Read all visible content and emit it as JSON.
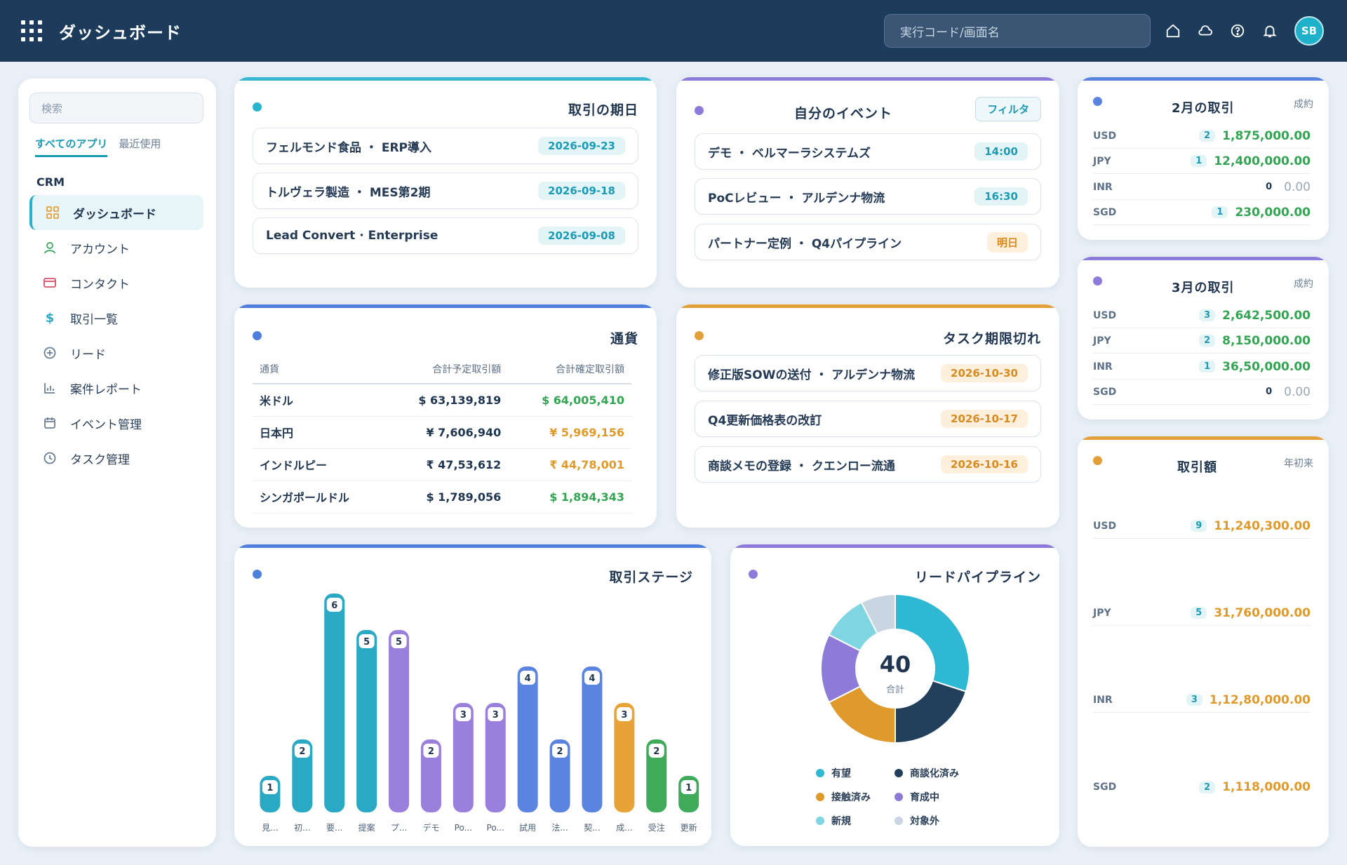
{
  "header": {
    "title": "ダッシュボード",
    "search_placeholder": "実行コード/画面名",
    "avatar": "SB",
    "icons": [
      "home-icon",
      "cloud-icon",
      "help-icon",
      "bell-icon"
    ]
  },
  "sidebar": {
    "search_placeholder": "検索",
    "tabs": [
      "すべてのアプリ",
      "最近使用"
    ],
    "section": "CRM",
    "items": [
      {
        "label": "ダッシュボード",
        "icon": "grid-icon"
      },
      {
        "label": "アカウント",
        "icon": "user-icon"
      },
      {
        "label": "コンタクト",
        "icon": "card-icon"
      },
      {
        "label": "取引一覧",
        "icon": "dollar-icon"
      },
      {
        "label": "リード",
        "icon": "plus-circle-icon"
      },
      {
        "label": "案件レポート",
        "icon": "bar-chart-icon"
      },
      {
        "label": "イベント管理",
        "icon": "calendar-icon"
      },
      {
        "label": "タスク管理",
        "icon": "clock-icon"
      }
    ]
  },
  "deals_due": {
    "title": "取引の期日",
    "items": [
      {
        "label": "フェルモンド食品 ・ ERP導入",
        "date": "2026-09-23"
      },
      {
        "label": "トルヴェラ製造 ・ MES第2期",
        "date": "2026-09-18"
      },
      {
        "label": "Lead Convert · Enterprise",
        "date": "2026-09-08"
      }
    ]
  },
  "my_events": {
    "title": "自分のイベント",
    "filter": "フィルタ",
    "items": [
      {
        "label": "デモ ・ ベルマーラシステムズ",
        "time": "14:00"
      },
      {
        "label": "PoCレビュー ・ アルデンナ物流",
        "time": "16:30"
      },
      {
        "label": "パートナー定例 ・ Q4パイプライン",
        "time": "明日"
      }
    ]
  },
  "feb_deals": {
    "title": "2月の取引",
    "sub": "成約",
    "rows": [
      {
        "code": "USD",
        "count": "2",
        "amount": "1,875,000.00"
      },
      {
        "code": "JPY",
        "count": "1",
        "amount": "12,400,000.00"
      },
      {
        "code": "INR",
        "count": "0",
        "amount": "0.00"
      },
      {
        "code": "SGD",
        "count": "1",
        "amount": "230,000.00"
      }
    ]
  },
  "mar_deals": {
    "title": "3月の取引",
    "sub": "成約",
    "rows": [
      {
        "code": "USD",
        "count": "3",
        "amount": "2,642,500.00"
      },
      {
        "code": "JPY",
        "count": "2",
        "amount": "8,150,000.00"
      },
      {
        "code": "INR",
        "count": "1",
        "amount": "36,50,000.00"
      },
      {
        "code": "SGD",
        "count": "0",
        "amount": "0.00"
      }
    ]
  },
  "deal_amount": {
    "title": "取引額",
    "sub": "年初来",
    "rows": [
      {
        "code": "USD",
        "count": "9",
        "amount": "11,240,300.00"
      },
      {
        "code": "JPY",
        "count": "5",
        "amount": "31,760,000.00"
      },
      {
        "code": "INR",
        "count": "3",
        "amount": "1,12,80,000.00"
      },
      {
        "code": "SGD",
        "count": "2",
        "amount": "1,118,000.00"
      }
    ]
  },
  "currency": {
    "title": "通貨",
    "headers": [
      "通貨",
      "合計予定取引額",
      "合計確定取引額"
    ],
    "rows": [
      {
        "name": "米ドル",
        "planned": "$ 63,139,819",
        "confirmed": "$ 64,005,410",
        "tone": "green"
      },
      {
        "name": "日本円",
        "planned": "¥ 7,606,940",
        "confirmed": "¥ 5,969,156",
        "tone": "orange"
      },
      {
        "name": "インドルピー",
        "planned": "₹ 47,53,612",
        "confirmed": "₹ 44,78,001",
        "tone": "orange"
      },
      {
        "name": "シンガポールドル",
        "planned": "$ 1,789,056",
        "confirmed": "$ 1,894,343",
        "tone": "green"
      }
    ]
  },
  "overdue_tasks": {
    "title": "タスク期限切れ",
    "items": [
      {
        "label": "修正版SOWの送付 ・ アルデンナ物流",
        "date": "2026-10-30"
      },
      {
        "label": "Q4更新価格表の改訂",
        "date": "2026-10-17"
      },
      {
        "label": "商談メモの登録 ・ クエンロー流通",
        "date": "2026-10-16"
      }
    ]
  },
  "deal_stage": {
    "title": "取引ステージ"
  },
  "lead_pipeline": {
    "title": "リードパイプライン",
    "total": "40",
    "total_label": "合計"
  },
  "chart_data": [
    {
      "type": "bar",
      "title": "取引ステージ",
      "categories": [
        "見...",
        "初...",
        "要...",
        "提案",
        "プ...",
        "デモ",
        "Po...",
        "Po...",
        "試用",
        "法...",
        "契...",
        "成...",
        "受注",
        "更新"
      ],
      "values": [
        1,
        2,
        6,
        5,
        5,
        2,
        3,
        3,
        4,
        2,
        4,
        3,
        2,
        1
      ],
      "colors": [
        "#2aa9c4",
        "#2aa9c4",
        "#2aa9c4",
        "#2aa9c4",
        "#9b7fdc",
        "#9b7fdc",
        "#9b7fdc",
        "#9b7fdc",
        "#5b84e0",
        "#5b84e0",
        "#5b84e0",
        "#e7a337",
        "#3fab5a",
        "#3fab5a"
      ],
      "ylim": [
        0,
        6
      ]
    },
    {
      "type": "pie",
      "title": "リードパイプライン",
      "categories": [
        "有望",
        "商談化済み",
        "接触済み",
        "育成中",
        "新規",
        "対象外"
      ],
      "values": [
        12,
        8,
        7,
        6,
        4,
        3
      ],
      "colors": [
        "#2fb8d4",
        "#223f5c",
        "#e09a2b",
        "#8e7bd9",
        "#7fd5e2",
        "#c9d6e1"
      ]
    }
  ]
}
